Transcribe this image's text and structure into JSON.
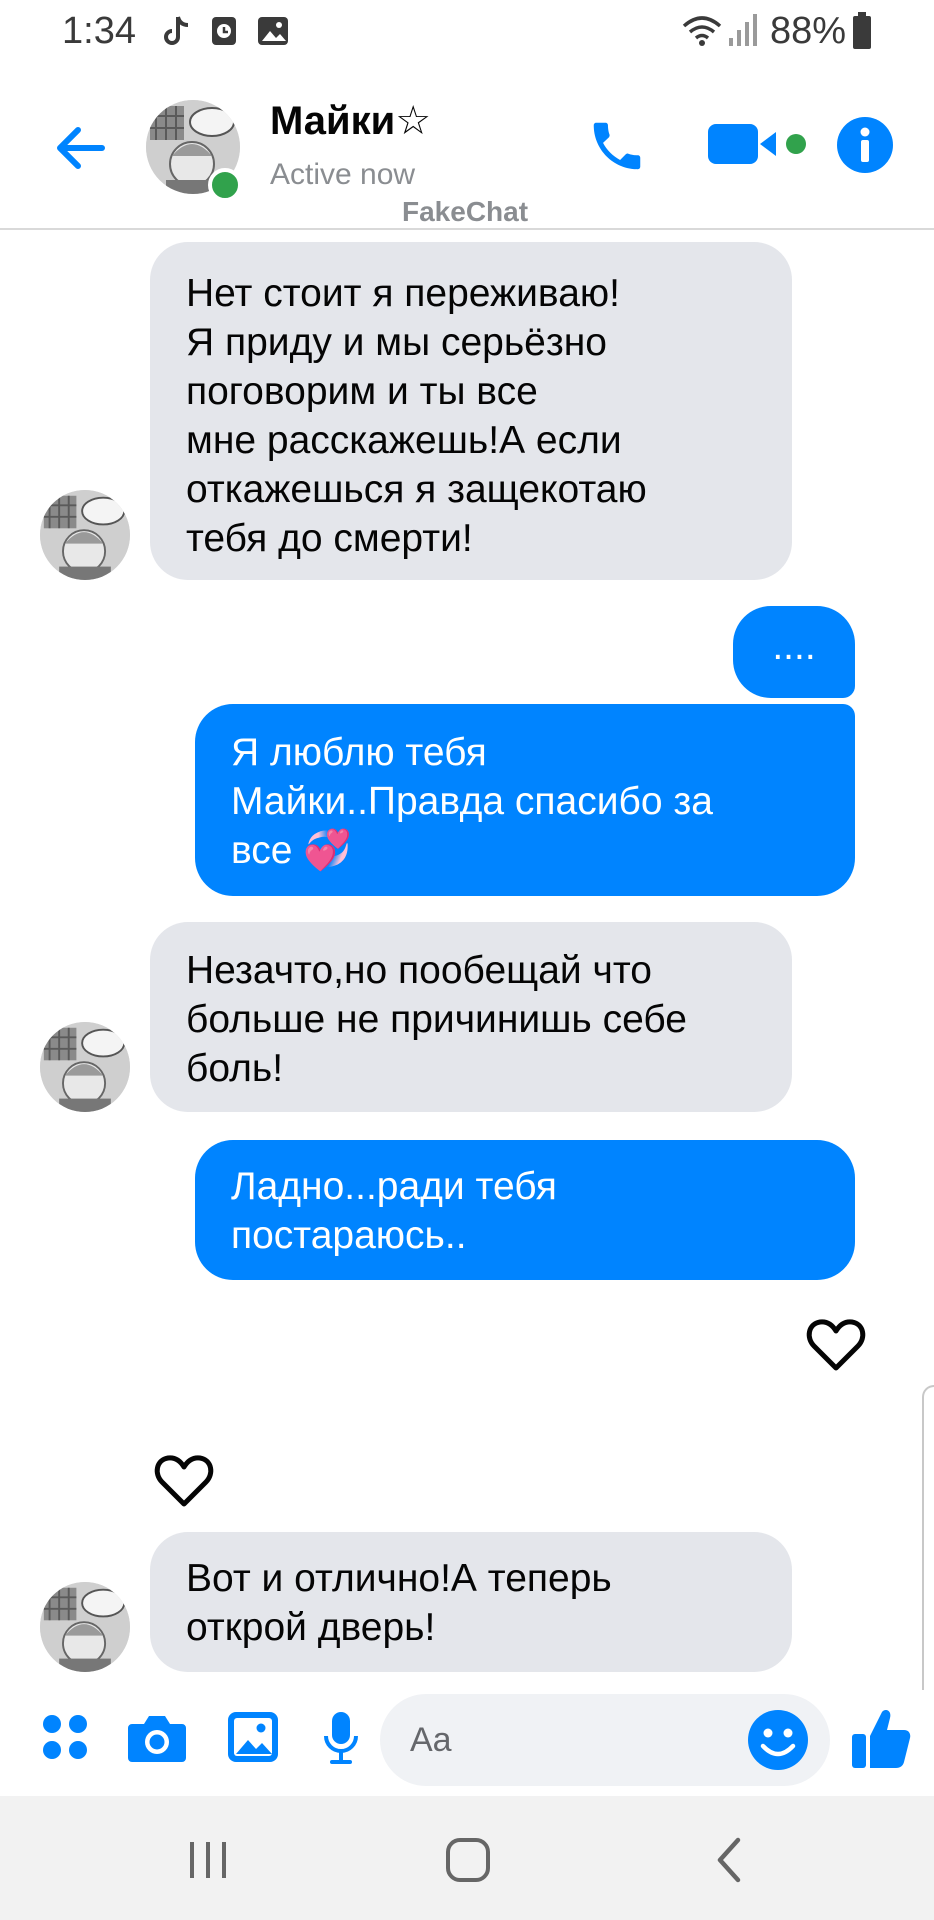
{
  "status_bar": {
    "time": "1:34",
    "battery": "88%",
    "icons": [
      "tiktok-icon",
      "alarm-icon",
      "image-icon",
      "wifi-icon",
      "signal-icon",
      "battery-icon"
    ]
  },
  "header": {
    "contact_name": "Майки☆",
    "status": "Active now",
    "watermark": "FakeChat"
  },
  "messages": [
    {
      "side": "in",
      "lines": [
        "Нет стоит я переживаю!",
        "Я приду и мы серьёзно",
        "поговорим и ты все",
        "мне расскажешь!А если",
        "откажешься я защекотаю",
        "тебя до смерти!"
      ]
    },
    {
      "side": "out",
      "lines": [
        "...."
      ]
    },
    {
      "side": "out",
      "lines": [
        "Я люблю тебя",
        "Майки..Правда спасибо за",
        "все 💞"
      ]
    },
    {
      "side": "in",
      "lines": [
        "Незачто,но пообещай что",
        "больше не причинишь себе",
        "боль!"
      ]
    },
    {
      "side": "out",
      "lines": [
        "Ладно...ради тебя",
        "постараюсь.."
      ]
    },
    {
      "side": "in",
      "lines": [
        "Вот и отлично!А теперь",
        "открой дверь!"
      ]
    }
  ],
  "composer": {
    "placeholder": "Aa"
  },
  "colors": {
    "accent": "#0084ff",
    "incoming_bubble": "#e4e6eb",
    "online": "#31a24c"
  }
}
